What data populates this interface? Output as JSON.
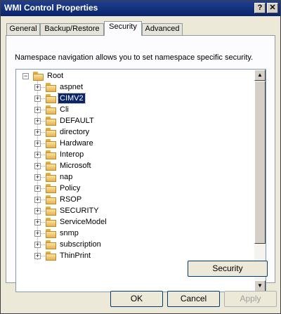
{
  "window": {
    "title": "WMI Control Properties",
    "help_glyph": "?",
    "close_glyph": "✕"
  },
  "tabs": [
    {
      "label": "General"
    },
    {
      "label": "Backup/Restore"
    },
    {
      "label": "Security"
    },
    {
      "label": "Advanced"
    }
  ],
  "security": {
    "description": "Namespace navigation allows you to set namespace specific security.",
    "tree": {
      "root": "Root",
      "children": [
        "aspnet",
        "CIMV2",
        "Cli",
        "DEFAULT",
        "directory",
        "Hardware",
        "Interop",
        "Microsoft",
        "nap",
        "Policy",
        "RSOP",
        "SECURITY",
        "ServiceModel",
        "snmp",
        "subscription",
        "ThinPrint"
      ],
      "selected": "CIMV2",
      "collapse_glyph": "−",
      "expand_glyph": "+"
    },
    "security_button": "Security"
  },
  "footer": {
    "ok": "OK",
    "cancel": "Cancel",
    "apply": "Apply"
  },
  "scrollbar": {
    "up_glyph": "▲",
    "down_glyph": "▼"
  }
}
